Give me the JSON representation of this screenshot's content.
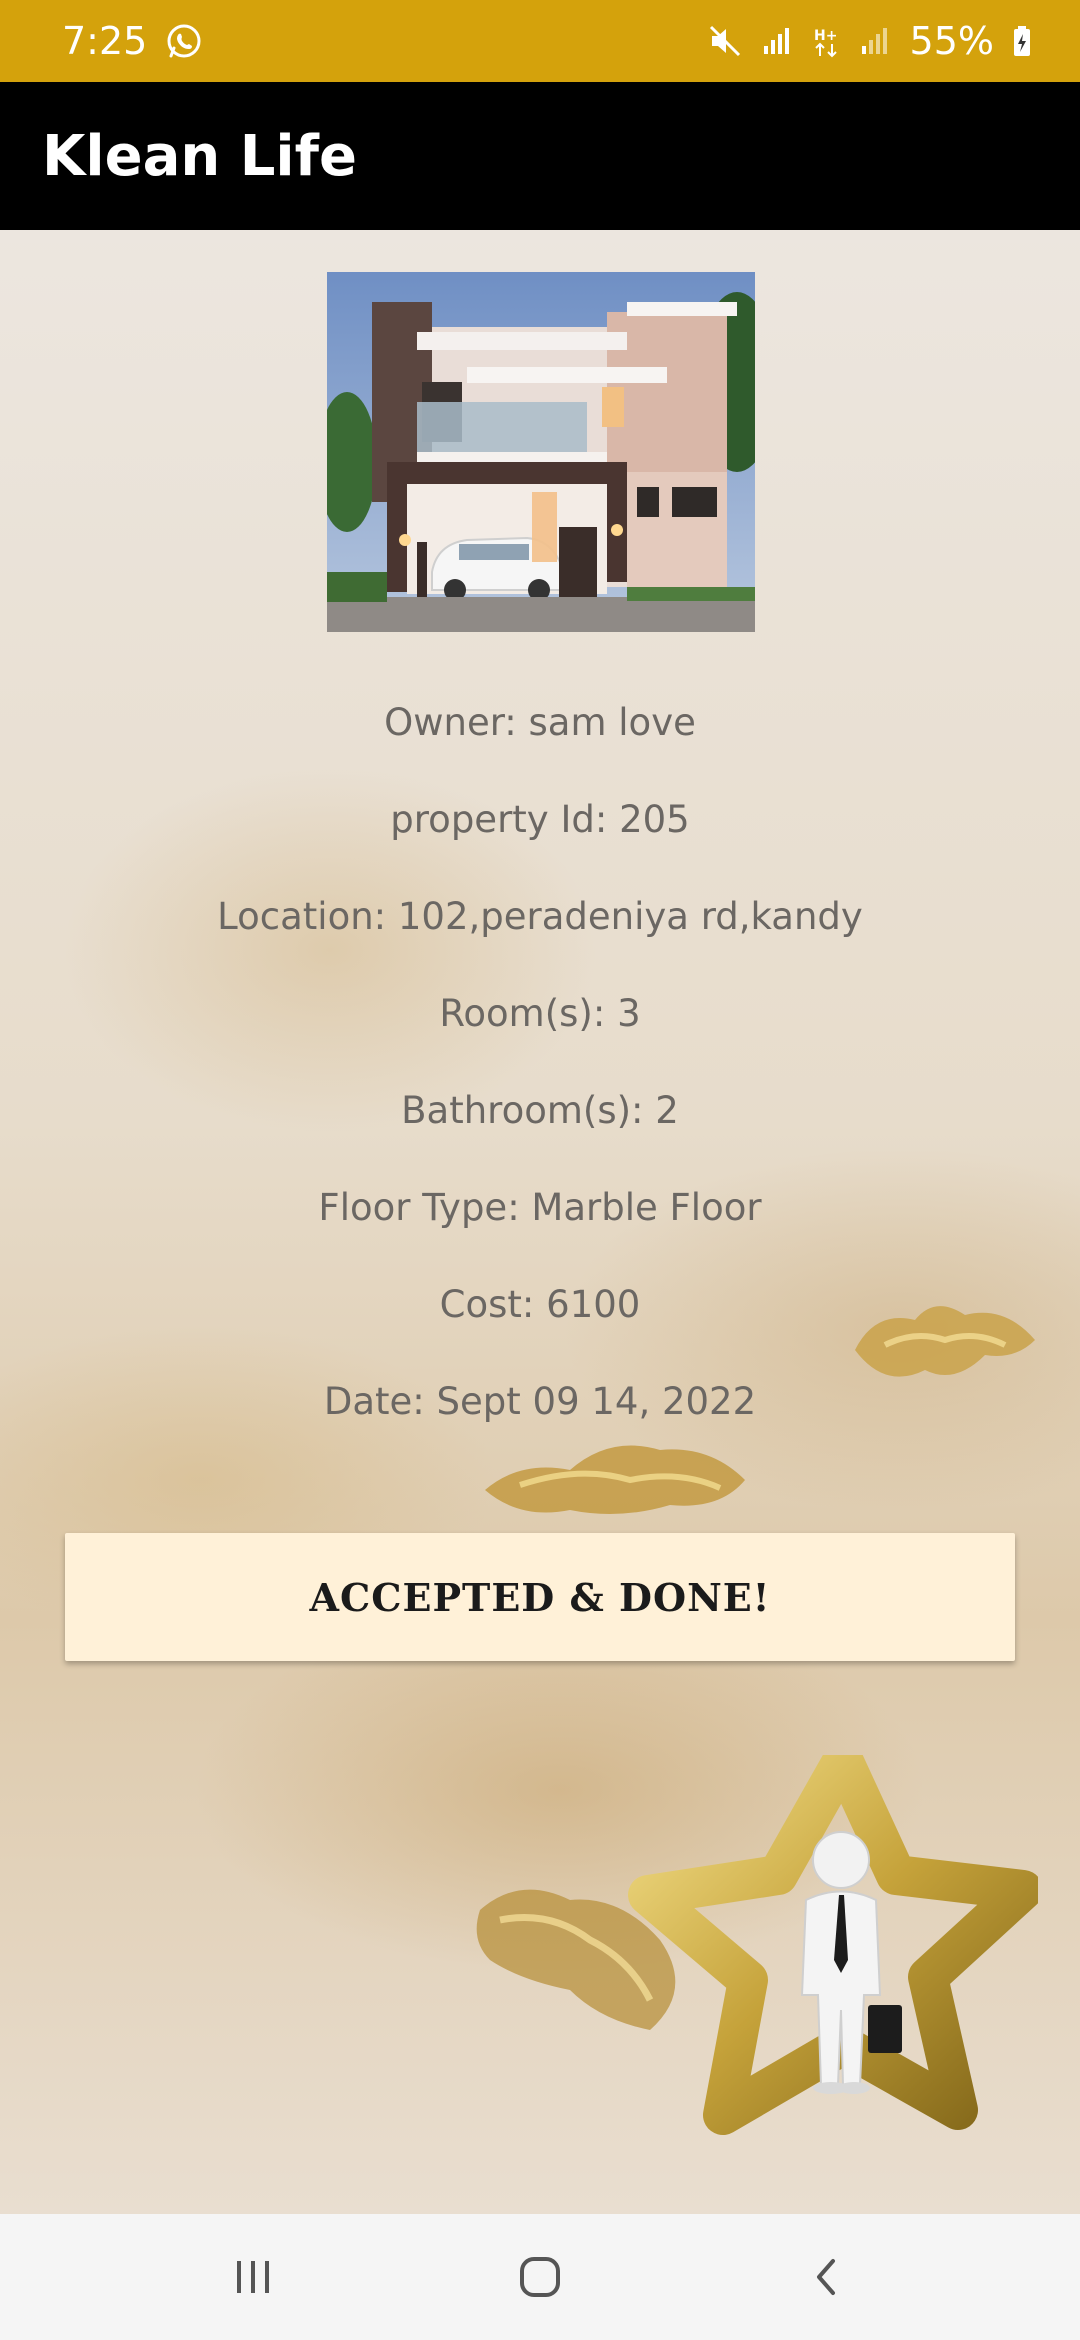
{
  "status_bar": {
    "time": "7:25",
    "battery_percent": "55%",
    "icons": [
      "whatsapp-icon",
      "mute-icon",
      "signal-icon",
      "data-hplus-icon",
      "signal-weak-icon",
      "battery-charging-icon"
    ],
    "color": "#d4a20c"
  },
  "app_bar": {
    "title": "Klean Life"
  },
  "property": {
    "image": "house-photo",
    "details": [
      "Owner: sam love",
      "property Id: 205",
      "Location: 102,peradeniya rd,kandy",
      "Room(s): 3",
      "Bathroom(s): 2",
      "Floor Type: Marble Floor",
      "Cost: 6100",
      "Date: Sept 09 14, 2022"
    ]
  },
  "action_button": {
    "label": "ACCEPTED & DONE!",
    "background": "#fff1d8"
  },
  "decor": {
    "mascot": "gold-star-businessman-illustration"
  },
  "nav_bar": {
    "buttons": [
      "recent-apps-icon",
      "home-icon",
      "back-icon"
    ]
  }
}
